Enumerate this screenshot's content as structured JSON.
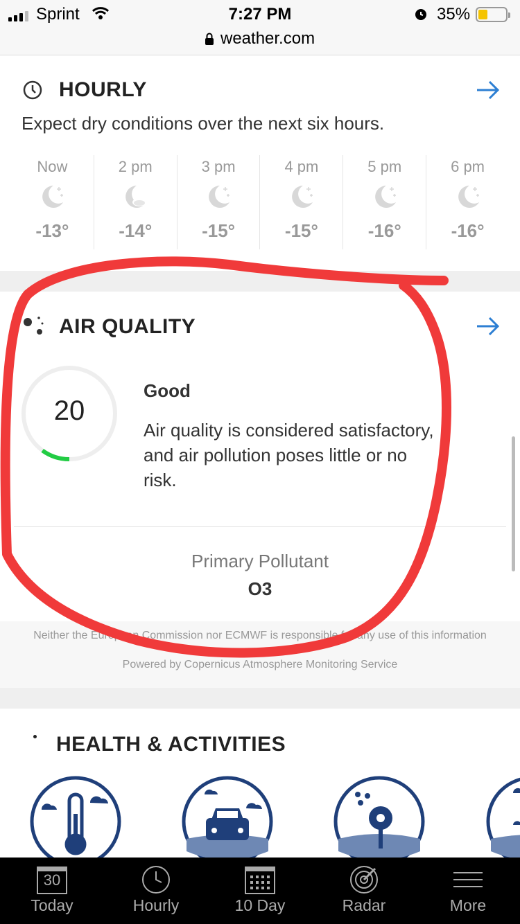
{
  "status_bar": {
    "carrier": "Sprint",
    "time": "7:27 PM",
    "battery_percent": "35%",
    "battery_level": 0.35
  },
  "url_bar": {
    "url": "weather.com"
  },
  "hourly": {
    "title": "HOURLY",
    "description": "Expect dry conditions over the next six hours.",
    "hours": [
      {
        "time": "Now",
        "temp": "-13°",
        "icon": "moon-stars-icon"
      },
      {
        "time": "2 pm",
        "temp": "-14°",
        "icon": "moon-cloud-icon"
      },
      {
        "time": "3 pm",
        "temp": "-15°",
        "icon": "moon-stars-icon"
      },
      {
        "time": "4 pm",
        "temp": "-15°",
        "icon": "moon-stars-icon"
      },
      {
        "time": "5 pm",
        "temp": "-16°",
        "icon": "moon-stars-icon"
      },
      {
        "time": "6 pm",
        "temp": "-16°",
        "icon": "moon-stars-icon"
      }
    ]
  },
  "air_quality": {
    "title": "AIR QUALITY",
    "index": "20",
    "status": "Good",
    "description": "Air quality is considered satisfactory, and air pollution poses little or no risk.",
    "gauge_color": "#22cc44",
    "pollutant_label": "Primary Pollutant",
    "pollutant_value": "O3"
  },
  "disclaimer": {
    "line1": "Neither the European Commission nor ECMWF is responsible for any use of this information",
    "line2": "Powered by Copernicus Atmosphere Monitoring Service"
  },
  "health": {
    "title": "HEALTH & ACTIVITIES"
  },
  "tab_bar": {
    "tabs": [
      {
        "label": "Today",
        "icon": "calendar-icon",
        "badge": "30"
      },
      {
        "label": "Hourly",
        "icon": "clock-icon"
      },
      {
        "label": "10 Day",
        "icon": "calendar-grid-icon"
      },
      {
        "label": "Radar",
        "icon": "radar-icon"
      },
      {
        "label": "More",
        "icon": "menu-icon"
      }
    ]
  },
  "colors": {
    "accent": "#2d7fd3",
    "annotation": "#f03a3a",
    "icon_navy": "#1f3f7a"
  }
}
